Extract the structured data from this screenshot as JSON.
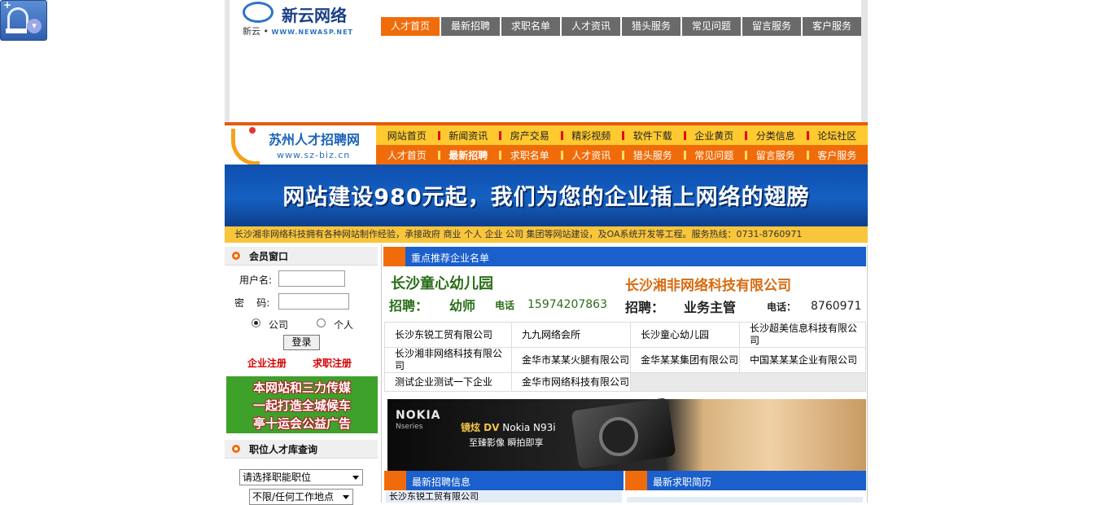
{
  "top_logo": {
    "name": "新云网络",
    "sub_prefix": "新云 •",
    "sub_url": "WWW.NEWASP.NET"
  },
  "top_nav": [
    "人才首页",
    "最新招聘",
    "求职名单",
    "人才资讯",
    "猎头服务",
    "常见问题",
    "留言服务",
    "客户服务"
  ],
  "site_logo": {
    "name": "苏州人才招聘网",
    "url": "www.sz-biz.cn"
  },
  "nav_primary": [
    "网站首页",
    "新闻资讯",
    "房产交易",
    "精彩视频",
    "软件下载",
    "企业黄页",
    "分类信息",
    "论坛社区"
  ],
  "nav_secondary": [
    "人才首页",
    "最新招聘",
    "求职名单",
    "人才资讯",
    "猎头服务",
    "常见问题",
    "留言服务",
    "客户服务"
  ],
  "banner_text": "网站建设980元起，我们为您的企业插上网络的翅膀",
  "ticker": "长沙湘非网络科技拥有各种网站制作经验，承接政府 商业 个人 企业 公司 集团等网站建设，及OA系统开发等工程。服务热线：0731-8760971",
  "member": {
    "title": "会员窗口",
    "username_label": "用户名:",
    "password_label": "密    码:",
    "radio_company": "公司",
    "radio_person": "个人",
    "login_button": "登录",
    "company_register": "企业注册",
    "job_register": "求职注册"
  },
  "left_ad": [
    "本网站和三力传媒",
    "一起打造全城候车",
    "亭十运会公益广告"
  ],
  "search": {
    "title": "职位人才库查询",
    "position_select": "请选择职能职位",
    "location_select": "不限/任何工作地点"
  },
  "featured": {
    "title": "重点推荐企业名单",
    "left": {
      "name": "长沙童心幼儿园",
      "hire": "招聘：",
      "job": "幼师",
      "tel_label": "电话",
      "tel": "15974207863"
    },
    "right": {
      "name": "长沙湘非网络科技有限公司",
      "hire": "招聘：",
      "job": "业务主管",
      "tel_label": "电话：",
      "tel": "8760971"
    }
  },
  "companies": [
    [
      "长沙东锐工贸有限公司",
      "九九网络会所",
      "长沙童心幼儿园",
      "长沙超美信息科技有限公司"
    ],
    [
      "长沙湘非网络科技有限公司",
      "金华市某某火腿有限公司",
      "金华某某集团有限公司",
      "中国某某某企业有限公司"
    ],
    [
      "测试企业测试一下企业",
      "金华市网络科技有限公司",
      "",
      ""
    ]
  ],
  "nokia_ad": {
    "brand": "NOKIA",
    "series": "Nseries",
    "slogan_a": "镜炫 DV",
    "model": "Nokia N93i",
    "slogan_b": "至臻影像  瞬拍即享"
  },
  "latest_jobs": {
    "title": "最新招聘信息",
    "items": [
      "长沙东锐工贸有限公司"
    ]
  },
  "latest_resumes": {
    "title": "最新求职简历",
    "items": [
      ""
    ]
  }
}
